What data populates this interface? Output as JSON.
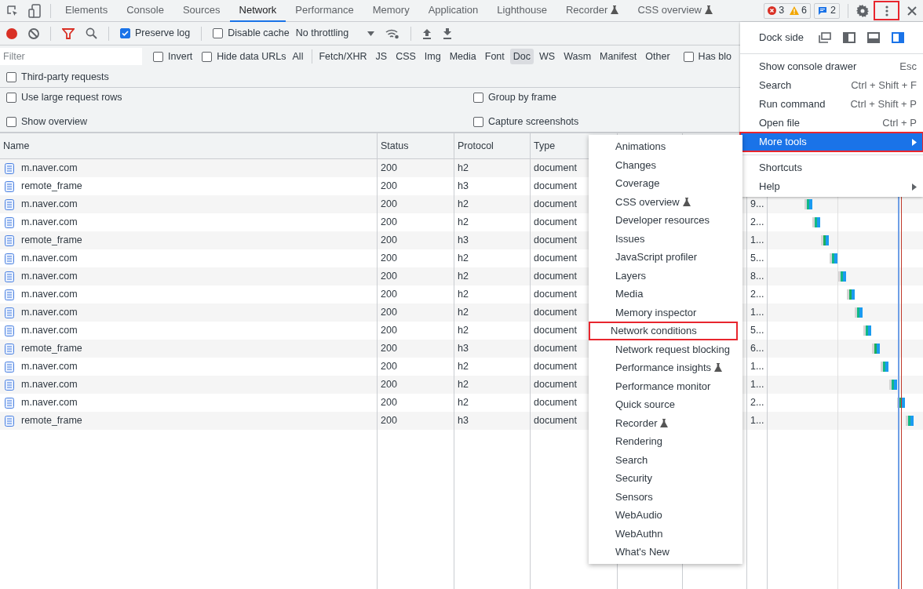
{
  "panel_tabs": [
    {
      "label": "Elements",
      "selected": false,
      "experimental": false
    },
    {
      "label": "Console",
      "selected": false,
      "experimental": false
    },
    {
      "label": "Sources",
      "selected": false,
      "experimental": false
    },
    {
      "label": "Network",
      "selected": true,
      "experimental": false
    },
    {
      "label": "Performance",
      "selected": false,
      "experimental": false
    },
    {
      "label": "Memory",
      "selected": false,
      "experimental": false
    },
    {
      "label": "Application",
      "selected": false,
      "experimental": false
    },
    {
      "label": "Lighthouse",
      "selected": false,
      "experimental": false
    },
    {
      "label": "Recorder",
      "selected": false,
      "experimental": true
    },
    {
      "label": "CSS overview",
      "selected": false,
      "experimental": true
    }
  ],
  "counters": {
    "errors": "3",
    "warnings": "6",
    "messages": "2"
  },
  "kebab_annotated": true,
  "toolbar": {
    "recording": true,
    "preserve_log": {
      "label": "Preserve log",
      "checked": true
    },
    "disable_cache": {
      "label": "Disable cache",
      "checked": false
    },
    "throttling": "No throttling"
  },
  "filter": {
    "placeholder": "Filter",
    "invert": {
      "label": "Invert",
      "checked": false
    },
    "hide_data_urls": {
      "label": "Hide data URLs",
      "checked": false
    },
    "types": [
      {
        "label": "All",
        "selected": false
      },
      {
        "label": "Fetch/XHR",
        "selected": false
      },
      {
        "label": "JS",
        "selected": false
      },
      {
        "label": "CSS",
        "selected": false
      },
      {
        "label": "Img",
        "selected": false
      },
      {
        "label": "Media",
        "selected": false
      },
      {
        "label": "Font",
        "selected": false
      },
      {
        "label": "Doc",
        "selected": true
      },
      {
        "label": "WS",
        "selected": false
      },
      {
        "label": "Wasm",
        "selected": false
      },
      {
        "label": "Manifest",
        "selected": false
      },
      {
        "label": "Other",
        "selected": false
      }
    ],
    "has_blocked": {
      "label": "Has blo",
      "checked": false
    },
    "third_party": {
      "label": "Third-party requests",
      "checked": false
    }
  },
  "settings": [
    {
      "label": "Use large request rows",
      "checked": false
    },
    {
      "label": "Group by frame",
      "checked": false
    },
    {
      "label": "Show overview",
      "checked": false
    },
    {
      "label": "Capture screenshots",
      "checked": false
    }
  ],
  "table": {
    "columns": [
      "Name",
      "Status",
      "Protocol",
      "Type"
    ],
    "rows": [
      {
        "name": "m.naver.com",
        "status": "200",
        "protocol": "h2",
        "type": "document"
      },
      {
        "name": "remote_frame",
        "status": "200",
        "protocol": "h3",
        "type": "document"
      },
      {
        "name": "m.naver.com",
        "status": "200",
        "protocol": "h2",
        "type": "document",
        "time": "9..."
      },
      {
        "name": "m.naver.com",
        "status": "200",
        "protocol": "h2",
        "type": "document",
        "time": "2..."
      },
      {
        "name": "remote_frame",
        "status": "200",
        "protocol": "h3",
        "type": "document",
        "time": "1..."
      },
      {
        "name": "m.naver.com",
        "status": "200",
        "protocol": "h2",
        "type": "document",
        "time": "5..."
      },
      {
        "name": "m.naver.com",
        "status": "200",
        "protocol": "h2",
        "type": "document",
        "time": "8..."
      },
      {
        "name": "m.naver.com",
        "status": "200",
        "protocol": "h2",
        "type": "document",
        "time": "2..."
      },
      {
        "name": "m.naver.com",
        "status": "200",
        "protocol": "h2",
        "type": "document",
        "time": "1..."
      },
      {
        "name": "m.naver.com",
        "status": "200",
        "protocol": "h2",
        "type": "document",
        "time": "5..."
      },
      {
        "name": "remote_frame",
        "status": "200",
        "protocol": "h3",
        "type": "document",
        "time": "6..."
      },
      {
        "name": "m.naver.com",
        "status": "200",
        "protocol": "h2",
        "type": "document",
        "time": "1..."
      },
      {
        "name": "m.naver.com",
        "status": "200",
        "protocol": "h2",
        "type": "document",
        "time": "1..."
      },
      {
        "name": "m.naver.com",
        "status": "200",
        "protocol": "h2",
        "type": "document",
        "time": "2..."
      },
      {
        "name": "remote_frame",
        "status": "200",
        "protocol": "h3",
        "type": "document",
        "time": "1..."
      }
    ]
  },
  "main_menu": {
    "dock_side": {
      "label": "Dock side",
      "options": [
        {
          "selected": false
        },
        {
          "selected": false
        },
        {
          "selected": false
        },
        {
          "selected": true
        }
      ]
    },
    "groups": [
      [
        {
          "label": "Show console drawer",
          "shortcut": "Esc",
          "highlighted": false,
          "submenu": false,
          "annotated": false
        },
        {
          "label": "Search",
          "shortcut": "Ctrl + Shift + F",
          "highlighted": false,
          "submenu": false,
          "annotated": false
        },
        {
          "label": "Run command",
          "shortcut": "Ctrl + Shift + P",
          "highlighted": false,
          "submenu": false,
          "annotated": false
        },
        {
          "label": "Open file",
          "shortcut": "Ctrl + P",
          "highlighted": false,
          "submenu": false,
          "annotated": false
        },
        {
          "label": "More tools",
          "highlighted": true,
          "submenu": true,
          "annotated": true
        }
      ],
      [
        {
          "label": "Shortcuts",
          "highlighted": false,
          "submenu": false,
          "annotated": false
        },
        {
          "label": "Help",
          "highlighted": false,
          "submenu": true,
          "annotated": false
        }
      ]
    ]
  },
  "more_tools": [
    {
      "label": "Animations",
      "experimental": false,
      "annotated": false
    },
    {
      "label": "Changes",
      "experimental": false,
      "annotated": false
    },
    {
      "label": "Coverage",
      "experimental": false,
      "annotated": false
    },
    {
      "label": "CSS overview",
      "experimental": true,
      "annotated": false
    },
    {
      "label": "Developer resources",
      "experimental": false,
      "annotated": false
    },
    {
      "label": "Issues",
      "experimental": false,
      "annotated": false
    },
    {
      "label": "JavaScript profiler",
      "experimental": false,
      "annotated": false
    },
    {
      "label": "Layers",
      "experimental": false,
      "annotated": false
    },
    {
      "label": "Media",
      "experimental": false,
      "annotated": false
    },
    {
      "label": "Memory inspector",
      "experimental": false,
      "annotated": false
    },
    {
      "label": "Network conditions",
      "experimental": false,
      "annotated": true
    },
    {
      "label": "Network request blocking",
      "experimental": false,
      "annotated": false
    },
    {
      "label": "Performance insights",
      "experimental": true,
      "annotated": false
    },
    {
      "label": "Performance monitor",
      "experimental": false,
      "annotated": false
    },
    {
      "label": "Quick source",
      "experimental": false,
      "annotated": false
    },
    {
      "label": "Recorder",
      "experimental": true,
      "annotated": false
    },
    {
      "label": "Rendering",
      "experimental": false,
      "annotated": false
    },
    {
      "label": "Search",
      "experimental": false,
      "annotated": false
    },
    {
      "label": "Security",
      "experimental": false,
      "annotated": false
    },
    {
      "label": "Sensors",
      "experimental": false,
      "annotated": false
    },
    {
      "label": "WebAudio",
      "experimental": false,
      "annotated": false
    },
    {
      "label": "WebAuthn",
      "experimental": false,
      "annotated": false
    },
    {
      "label": "What's New",
      "experimental": false,
      "annotated": false
    }
  ]
}
